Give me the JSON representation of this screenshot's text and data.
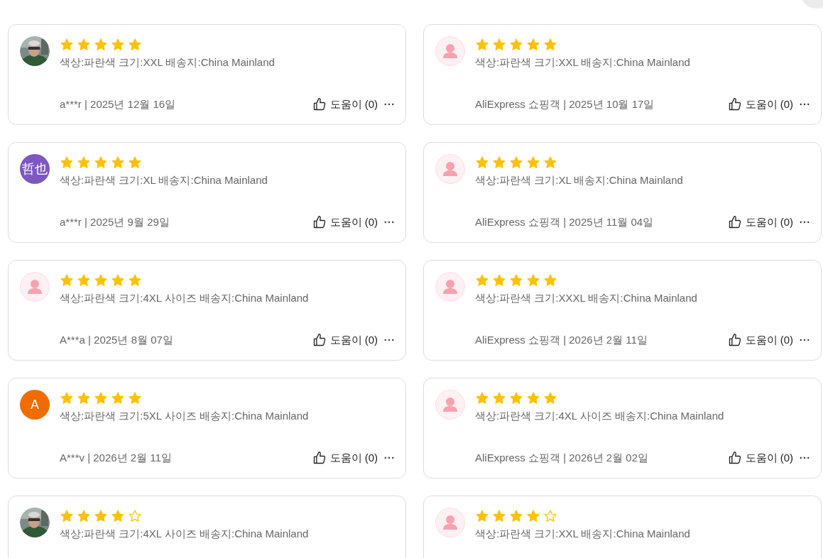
{
  "reviews": [
    {
      "stars": 5,
      "attributes": "색상:파란색 크기:XXL 배송지:China Mainland",
      "author_date": "a***r | 2025년 12월 16일",
      "helpful": "도움이 (0)"
    },
    {
      "avatar": {
        "kind": "default"
      },
      "stars": 5,
      "attributes": "색상:파란색 크기:XXL 배송지:China Mainland",
      "author_date": "AliExpress 쇼핑객 | 2025년 10월 17일",
      "helpful": "도움이 (0)"
    },
    {
      "avatar": {
        "kind": "initials",
        "text": "哲也",
        "color": "#7e57c2"
      },
      "stars": 5,
      "attributes": "색상:파란색 크기:XL 배송지:China Mainland",
      "author_date": "a***r | 2025년 9월 29일",
      "helpful": "도움이 (0)"
    },
    {
      "avatar": {
        "kind": "default"
      },
      "stars": 5,
      "attributes": "색상:파란색 크기:XL 배송지:China Mainland",
      "author_date": "AliExpress 쇼핑객 | 2025년 11월 04일",
      "helpful": "도움이 (0)"
    },
    {
      "avatar": {
        "kind": "default"
      },
      "stars": 5,
      "attributes": "색상:파란색 크기:4XL 사이즈 배송지:China Mainland",
      "author_date": "A***a | 2025년 8월 07일",
      "helpful": "도움이 (0)"
    },
    {
      "avatar": {
        "kind": "default"
      },
      "stars": 5,
      "attributes": "색상:파란색 크기:XXXL 배송지:China Mainland",
      "author_date": "AliExpress 쇼핑객 | 2026년 2월 11일",
      "helpful": "도움이 (0)"
    },
    {
      "avatar": {
        "kind": "initials",
        "text": "A",
        "color": "#ef6c00"
      },
      "stars": 5,
      "attributes": "색상:파란색 크기:5XL 사이즈 배송지:China Mainland",
      "author_date": "A***v | 2026년 2월 11일",
      "helpful": "도움이 (0)"
    },
    {
      "avatar": {
        "kind": "default"
      },
      "stars": 5,
      "attributes": "색상:파란색 크기:4XL 사이즈 배송지:China Mainland",
      "author_date": "AliExpress 쇼핑객 | 2026년 2월 02일",
      "helpful": "도움이 (0)"
    },
    {
      "stars": 4,
      "attributes": "색상:파란색 크기:4XL 사이즈 배송지:China Mainland"
    },
    {
      "avatar": {
        "kind": "default"
      },
      "stars": 4,
      "attributes": "색상:파란색 크기:XXL 배송지:China Mainland"
    }
  ]
}
